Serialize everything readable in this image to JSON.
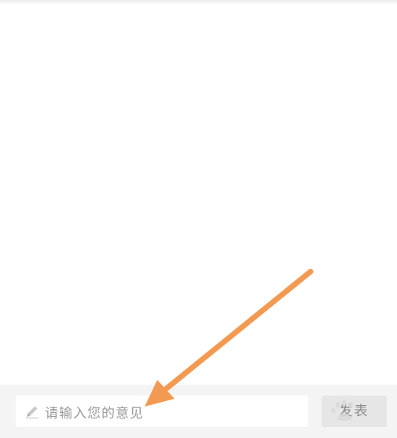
{
  "comment_bar": {
    "placeholder": "请输入您的意见",
    "send_label": "发表",
    "pencil_icon": "pencil-icon"
  },
  "annotation": {
    "arrow_icon": "arrow-icon",
    "arrow_color": "#f39a52"
  },
  "watermark": {
    "icon": "baidu-paw-icon"
  }
}
